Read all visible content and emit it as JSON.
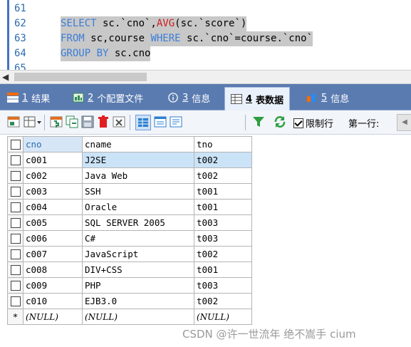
{
  "editor": {
    "lines": [
      {
        "num": "61",
        "segments": []
      },
      {
        "num": "62",
        "segments": [
          {
            "t": "SELECT",
            "cls": "kw"
          },
          {
            "t": " sc.`cno`,",
            "cls": ""
          },
          {
            "t": "AVG",
            "cls": "fn"
          },
          {
            "t": "(sc.`score`)",
            "cls": ""
          }
        ]
      },
      {
        "num": "63",
        "segments": [
          {
            "t": "FROM",
            "cls": "kw"
          },
          {
            "t": " sc,course ",
            "cls": ""
          },
          {
            "t": "WHERE",
            "cls": "kw"
          },
          {
            "t": " sc.`cno`=course.`cno`",
            "cls": ""
          }
        ]
      },
      {
        "num": "64",
        "segments": [
          {
            "t": "GROUP BY",
            "cls": "kw"
          },
          {
            "t": " sc.cno",
            "cls": ""
          }
        ]
      },
      {
        "num": "65",
        "segments": []
      }
    ]
  },
  "tabs": [
    {
      "key": "1",
      "label": "结果",
      "icon": "result-icon",
      "active": false
    },
    {
      "key": "2",
      "label": "个配置文件",
      "icon": "profile-icon",
      "active": false
    },
    {
      "key": "3",
      "label": "信息",
      "icon": "info-icon",
      "active": false
    },
    {
      "key": "4",
      "label": "表数据",
      "icon": "table-data-icon",
      "active": true
    },
    {
      "key": "5",
      "label": "信息",
      "icon": "info2-icon",
      "active": false
    }
  ],
  "toolbar": {
    "limit_label": "限制行",
    "limit_checked": true,
    "first_row_label": "第一行:"
  },
  "grid": {
    "columns": [
      "cno",
      "cname",
      "tno"
    ],
    "rows": [
      [
        "c001",
        "J2SE",
        "t002"
      ],
      [
        "c002",
        "Java Web",
        "t002"
      ],
      [
        "c003",
        "SSH",
        "t001"
      ],
      [
        "c004",
        "Oracle",
        "t001"
      ],
      [
        "c005",
        "SQL SERVER 2005",
        "t003"
      ],
      [
        "c006",
        "C#",
        "t003"
      ],
      [
        "c007",
        "JavaScript",
        "t002"
      ],
      [
        "c008",
        "DIV+CSS",
        "t001"
      ],
      [
        "c009",
        "PHP",
        "t003"
      ],
      [
        "c010",
        "EJB3.0",
        "t002"
      ]
    ],
    "null_marker": "*",
    "null_value": "(NULL)"
  },
  "watermark": "CSDN @许一世流年 绝不嵩手 cium",
  "colors": {
    "tab_bar": "#5a7bb0",
    "keyword": "#3b7dd8",
    "function": "#cc1f1f",
    "selection": "#cbe3f7"
  }
}
